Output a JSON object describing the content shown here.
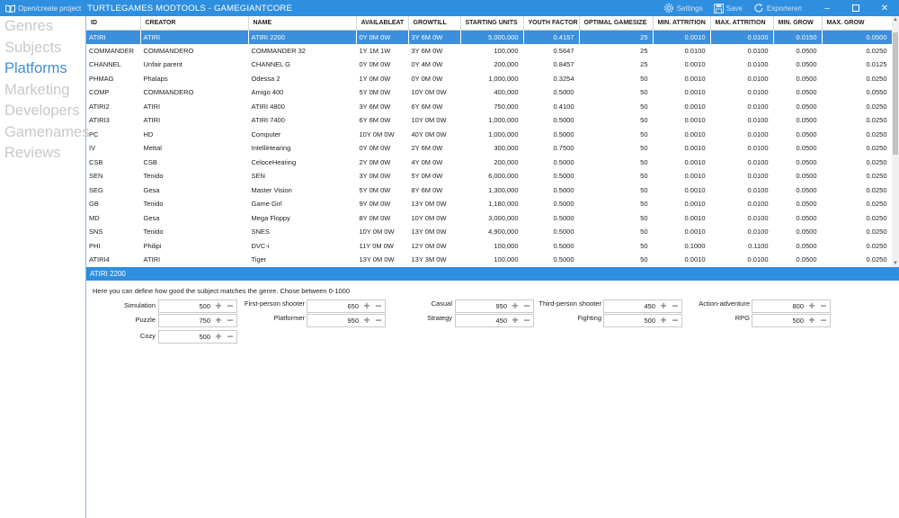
{
  "titlebar": {
    "open_label": "Open/create project",
    "title": "TURTLEGAMES MODTOOLS - GAMEGIANTCORE",
    "settings_label": "Settings",
    "save_label": "Save",
    "export_label": "Exporteren"
  },
  "sidebar": {
    "items": [
      {
        "label": "Genres",
        "active": false
      },
      {
        "label": "Subjects",
        "active": false
      },
      {
        "label": "Platforms",
        "active": true
      },
      {
        "label": "Marketing",
        "active": false
      },
      {
        "label": "Developers",
        "active": false
      },
      {
        "label": "Gamenames",
        "active": false
      },
      {
        "label": "Reviews",
        "active": false
      }
    ]
  },
  "table": {
    "columns": [
      "ID",
      "CREATOR",
      "NAME",
      "AVAILABLEAT",
      "GROWTILL",
      "STARTING UNITS",
      "YOUTH FACTOR",
      "OPTIMAL GAMESIZE",
      "MIN. ATTRITION",
      "MAX. ATTRITION",
      "MIN. GROW",
      "MAX. GROW"
    ],
    "selected_index": 0,
    "rows": [
      [
        "ATIRI",
        "ATIRI",
        "ATIRI 2200",
        "0Y 0M 0W",
        "3Y 6M 0W",
        "5,000,000",
        "0.4157",
        "25",
        "0.0010",
        "0.0100",
        "0.0150",
        "0.0500"
      ],
      [
        "COMMANDER",
        "COMMANDERO",
        "COMMANDER 32",
        "1Y 1M 1W",
        "3Y 6M 0W",
        "100,000",
        "0.5647",
        "25",
        "0.0100",
        "0.0100",
        "0.0500",
        "0.0250"
      ],
      [
        "CHANNEL",
        "Unfair parent",
        "CHANNEL G",
        "0Y 0M 0W",
        "0Y 4M 0W",
        "200,000",
        "0.8457",
        "25",
        "0.0010",
        "0.0100",
        "0.0500",
        "0.0125"
      ],
      [
        "PHMAG",
        "Phalaps",
        "Odessa 2",
        "1Y 0M 0W",
        "0Y 0M 0W",
        "1,000,000",
        "0.3254",
        "50",
        "0.0010",
        "0.0100",
        "0.0500",
        "0.0250"
      ],
      [
        "COMP",
        "COMMANDERO",
        "Amigo 400",
        "5Y 0M 0W",
        "10Y 0M 0W",
        "400,000",
        "0.5000",
        "50",
        "0.0010",
        "0.0100",
        "0.0500",
        "0.0550"
      ],
      [
        "ATIRI2",
        "ATIRI",
        "ATIRI 4800",
        "3Y 6M 0W",
        "6Y 6M 0W",
        "750,000",
        "0.4100",
        "50",
        "0.0010",
        "0.0100",
        "0.0500",
        "0.0250"
      ],
      [
        "ATIRI3",
        "ATIRI",
        "ATIRI 7400",
        "6Y 6M 0W",
        "10Y 0M 0W",
        "1,000,000",
        "0.5000",
        "50",
        "0.0010",
        "0.0100",
        "0.0500",
        "0.0250"
      ],
      [
        "PC",
        "HD",
        "Computer",
        "10Y 0M 0W",
        "40Y 0M 0W",
        "1,000,000",
        "0.5000",
        "50",
        "0.0010",
        "0.0100",
        "0.0500",
        "0.0250"
      ],
      [
        "IV",
        "Mettal",
        "IntelliHearing",
        "0Y 0M 0W",
        "2Y 6M 0W",
        "300,000",
        "0.7500",
        "50",
        "0.0010",
        "0.0100",
        "0.0500",
        "0.0250"
      ],
      [
        "CSB",
        "CSB",
        "CeloceHearing",
        "2Y 0M 0W",
        "4Y 0M 0W",
        "200,000",
        "0.5000",
        "50",
        "0.0010",
        "0.0100",
        "0.0500",
        "0.0250"
      ],
      [
        "SEN",
        "Tenido",
        "SEN",
        "3Y 0M 0W",
        "5Y 0M 0W",
        "6,000,000",
        "0.5000",
        "50",
        "0.0010",
        "0.0100",
        "0.0500",
        "0.0250"
      ],
      [
        "SEG",
        "Gesa",
        "Master Vision",
        "5Y 0M 0W",
        "8Y 6M 0W",
        "1,300,000",
        "0.5000",
        "50",
        "0.0010",
        "0.0100",
        "0.0500",
        "0.0250"
      ],
      [
        "GB",
        "Tenido",
        "Game Girl",
        "9Y 0M 0W",
        "13Y 0M 0W",
        "1,180,000",
        "0.5000",
        "50",
        "0.0010",
        "0.0100",
        "0.0500",
        "0.0250"
      ],
      [
        "MD",
        "Gesa",
        "Mega Floppy",
        "8Y 0M 0W",
        "10Y 0M 0W",
        "3,000,000",
        "0.5000",
        "50",
        "0.0010",
        "0.0100",
        "0.0500",
        "0.0250"
      ],
      [
        "SNS",
        "Tenido",
        "SNES",
        "10Y 0M 0W",
        "13Y 0M 0W",
        "4,900,000",
        "0.5000",
        "50",
        "0.0010",
        "0.0100",
        "0.0500",
        "0.0250"
      ],
      [
        "PHI",
        "Philipi",
        "DVC-i",
        "11Y 0M 0W",
        "12Y 0M 0W",
        "100,000",
        "0.5000",
        "50",
        "0.1000",
        "0.1100",
        "0.0500",
        "0.0250"
      ],
      [
        "ATIRI4",
        "ATIRI",
        "Tiger",
        "13Y 0M 0W",
        "13Y 3M 0W",
        "100,000",
        "0.5000",
        "50",
        "0.0010",
        "0.0100",
        "0.0500",
        "0.0250"
      ]
    ]
  },
  "detail": {
    "header": "ATIRI 2200",
    "description": "Here you can define how good the subject matches the genre. Chose between 0-1000",
    "plus_glyph": "+",
    "minus_glyph": "−",
    "genres": [
      {
        "label": "Simulation",
        "value": "500"
      },
      {
        "label": "First-person shooter",
        "value": "650"
      },
      {
        "label": "Casual",
        "value": "950"
      },
      {
        "label": "Third-person shooter",
        "value": "450"
      },
      {
        "label": "Action-adventure",
        "value": "800"
      },
      {
        "label": "Puzzle",
        "value": "750"
      },
      {
        "label": "Platformer",
        "value": "950"
      },
      {
        "label": "Strategy",
        "value": "450"
      },
      {
        "label": "Fighting",
        "value": "500"
      },
      {
        "label": "RPG",
        "value": "500"
      },
      {
        "label": "Cozy",
        "value": "500"
      }
    ]
  }
}
